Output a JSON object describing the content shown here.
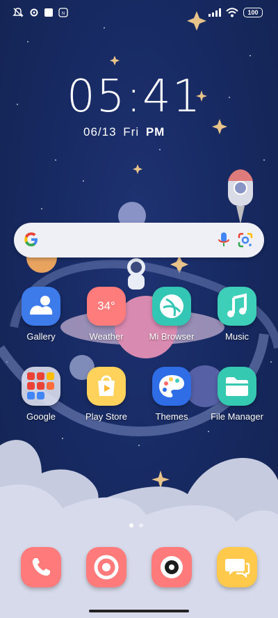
{
  "status_bar": {
    "icons": [
      "notifications-off-icon",
      "settings-icon",
      "square-icon",
      "nfc-icon"
    ],
    "right_icons": [
      "signal-icon",
      "wifi-icon"
    ],
    "battery": "100"
  },
  "clock": {
    "time": "05:41",
    "date": "06/13",
    "day": "Fri",
    "ampm": "PM"
  },
  "search": {
    "icon": "google-icon",
    "mic": "mic-icon",
    "lens": "google-lens-icon"
  },
  "apps": [
    {
      "label": "Gallery",
      "icon": "gallery-icon"
    },
    {
      "label": "Weather",
      "icon": "weather-icon",
      "badge": "34°"
    },
    {
      "label": "Mi Browser",
      "icon": "browser-icon"
    },
    {
      "label": "Music",
      "icon": "music-icon"
    },
    {
      "label": "Google",
      "icon": "google-folder-icon"
    },
    {
      "label": "Play Store",
      "icon": "play-store-icon"
    },
    {
      "label": "Themes",
      "icon": "themes-icon"
    },
    {
      "label": "File Manager",
      "icon": "folder-icon"
    }
  ],
  "dock": [
    {
      "icon": "phone-icon"
    },
    {
      "icon": "chrome-icon"
    },
    {
      "icon": "camera-icon"
    },
    {
      "icon": "messages-icon"
    }
  ],
  "colors": {
    "gallery": "#3e7bea",
    "weather": "#ff7c7c",
    "browser": "#34c6b4",
    "music": "#3dcfb8",
    "play": "#ffd25c",
    "themes": "#2f6de6",
    "files": "#35c9b1",
    "dock_red": "#ff7b7b",
    "dock_yellow": "#ffc94b"
  },
  "page_indicator": {
    "pages": 2,
    "current": 1
  }
}
